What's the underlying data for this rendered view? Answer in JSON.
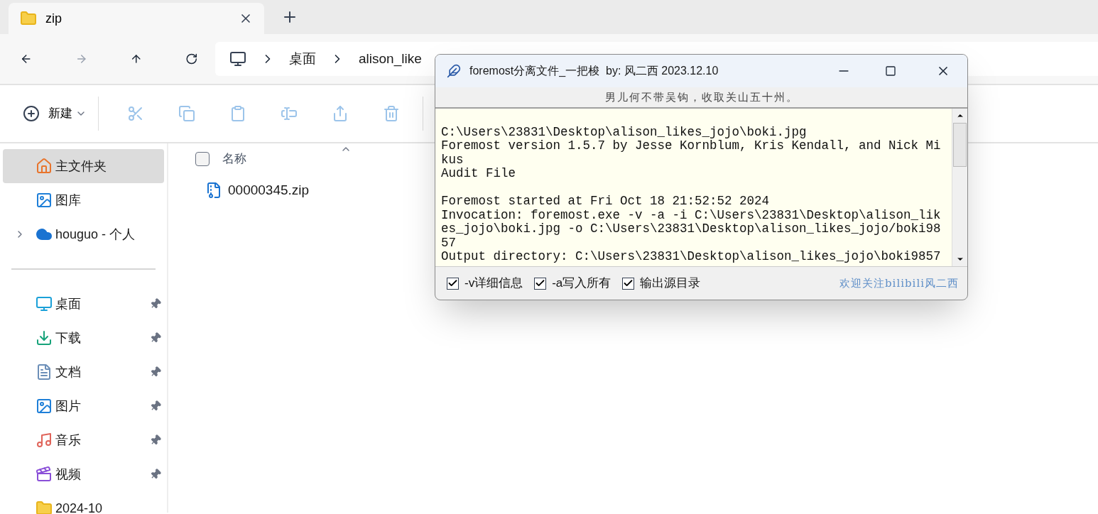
{
  "tab": {
    "title": "zip",
    "selected": true
  },
  "address": {
    "crumbs": [
      "桌面",
      "alison_like"
    ]
  },
  "toolbar": {
    "new_label": "新建"
  },
  "sidebar": {
    "items": [
      {
        "label": "主文件夹",
        "kind": "home",
        "selected": true,
        "pinned": false
      },
      {
        "label": "图库",
        "kind": "gallery",
        "selected": false,
        "pinned": false
      },
      {
        "label": "houguo - 个人",
        "kind": "cloud",
        "selected": false,
        "pinned": false,
        "expanded": false
      },
      {
        "kind": "divider"
      },
      {
        "label": "桌面",
        "kind": "desktop",
        "selected": false,
        "pinned": true
      },
      {
        "label": "下载",
        "kind": "download",
        "selected": false,
        "pinned": true
      },
      {
        "label": "文档",
        "kind": "documents",
        "selected": false,
        "pinned": true
      },
      {
        "label": "图片",
        "kind": "pictures",
        "selected": false,
        "pinned": true
      },
      {
        "label": "音乐",
        "kind": "music",
        "selected": false,
        "pinned": true
      },
      {
        "label": "视频",
        "kind": "video",
        "selected": false,
        "pinned": true
      },
      {
        "label": "2024-10",
        "kind": "folder",
        "selected": false,
        "pinned": false
      }
    ]
  },
  "file_list": {
    "column": "名称",
    "all_checked": false,
    "files": [
      {
        "name": "00000345.zip",
        "selected": false
      }
    ]
  },
  "dialog": {
    "title": "foremost分离文件_一把梭  by: 风二西 2023.12.10",
    "motto": "男儿何不带吴钩，收取关山五十州。",
    "log": [
      {
        "text": "C:\\Users\\23831\\Desktop\\alison_likes_jojo\\boki.jpg",
        "blank_before": true
      },
      {
        "text": "Foremost version 1.5.7 by Jesse Kornblum, Kris Kendall, and Nick Mikus",
        "blank_before": false
      },
      {
        "text": "Audit File",
        "blank_before": false
      },
      {
        "text": "Foremost started at Fri Oct 18 21:52:52 2024",
        "blank_before": true
      },
      {
        "text": "Invocation: foremost.exe -v -a -i C:\\Users\\23831\\Desktop\\alison_likes_jojo\\boki.jpg -o C:\\Users\\23831\\Desktop\\alison_likes_jojo/boki9857",
        "blank_before": false
      },
      {
        "text": "Output directory: C:\\Users\\23831\\Desktop\\alison_likes_jojo\\boki9857",
        "blank_before": false
      }
    ],
    "options": [
      {
        "label": "-v详细信息",
        "checked": true
      },
      {
        "label": "-a写入所有",
        "checked": true
      },
      {
        "label": "输出源目录",
        "checked": true
      }
    ],
    "credit": "欢迎关注bilibili风二西"
  }
}
